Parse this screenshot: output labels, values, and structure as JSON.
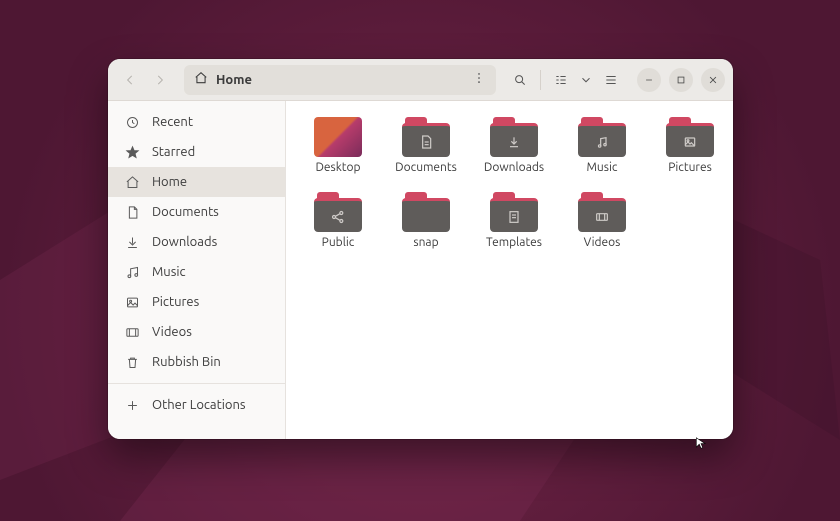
{
  "path": {
    "label": "Home"
  },
  "sidebar": {
    "items": [
      {
        "label": "Recent",
        "icon": "clock-icon"
      },
      {
        "label": "Starred",
        "icon": "star-icon"
      },
      {
        "label": "Home",
        "icon": "home-icon",
        "active": true
      },
      {
        "label": "Documents",
        "icon": "document-icon"
      },
      {
        "label": "Downloads",
        "icon": "download-icon"
      },
      {
        "label": "Music",
        "icon": "music-icon"
      },
      {
        "label": "Pictures",
        "icon": "picture-icon"
      },
      {
        "label": "Videos",
        "icon": "video-icon"
      },
      {
        "label": "Rubbish Bin",
        "icon": "trash-icon"
      }
    ],
    "other": {
      "label": "Other Locations"
    }
  },
  "files": [
    {
      "label": "Desktop",
      "kind": "desktop"
    },
    {
      "label": "Documents",
      "kind": "folder",
      "glyph": "document"
    },
    {
      "label": "Downloads",
      "kind": "folder",
      "glyph": "download"
    },
    {
      "label": "Music",
      "kind": "folder",
      "glyph": "music"
    },
    {
      "label": "Pictures",
      "kind": "folder",
      "glyph": "picture"
    },
    {
      "label": "Public",
      "kind": "folder",
      "glyph": "share"
    },
    {
      "label": "snap",
      "kind": "folder",
      "glyph": "none"
    },
    {
      "label": "Templates",
      "kind": "folder",
      "glyph": "template"
    },
    {
      "label": "Videos",
      "kind": "folder",
      "glyph": "video"
    }
  ]
}
